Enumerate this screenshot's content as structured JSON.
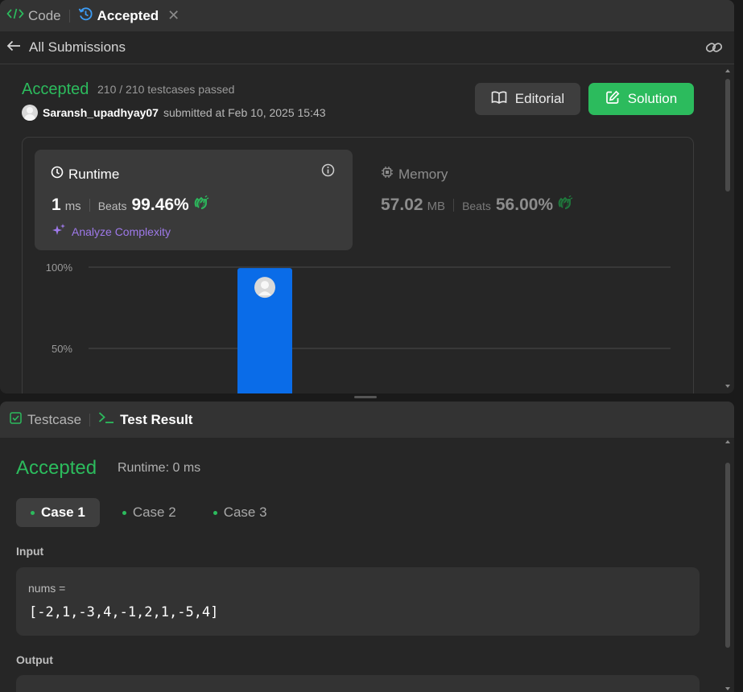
{
  "tabs": {
    "code_label": "Code",
    "accepted_label": "Accepted"
  },
  "nav": {
    "back_label": "All Submissions"
  },
  "submission": {
    "status": "Accepted",
    "testcases": "210 / 210 testcases passed",
    "username": "Saransh_upadhyay07",
    "submitted_text": "submitted at Feb 10, 2025 15:43"
  },
  "buttons": {
    "editorial": "Editorial",
    "solution": "Solution"
  },
  "runtime": {
    "label": "Runtime",
    "value": "1",
    "unit": "ms",
    "beats_label": "Beats",
    "beats_value": "99.46%",
    "analyze_label": "Analyze Complexity"
  },
  "memory": {
    "label": "Memory",
    "value": "57.02",
    "unit": "MB",
    "beats_label": "Beats",
    "beats_value": "56.00%"
  },
  "chart_data": {
    "type": "bar",
    "ytick_labels": [
      "100%",
      "50%"
    ],
    "ylim": [
      0,
      100
    ],
    "values": [
      99.46
    ],
    "grid": true
  },
  "test_panel": {
    "testcase_tab": "Testcase",
    "result_tab": "Test Result",
    "status": "Accepted",
    "runtime_text": "Runtime: 0 ms",
    "cases": [
      "Case 1",
      "Case 2",
      "Case 3"
    ],
    "input_label": "Input",
    "input_var": "nums =",
    "input_value": "[-2,1,-3,4,-1,2,1,-5,4]",
    "output_label": "Output"
  },
  "colors": {
    "accent_green": "#2cbb5d",
    "bar_blue": "#0a6ce8",
    "analyze_purple": "#9e79e9",
    "tab_blue": "#3c9cf5"
  }
}
